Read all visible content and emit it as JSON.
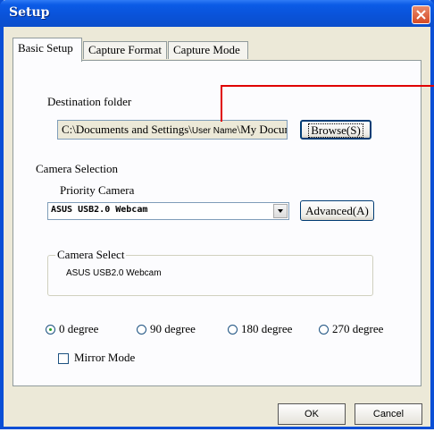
{
  "window": {
    "title": "Setup"
  },
  "tabs": [
    {
      "label": "Basic Setup",
      "active": true
    },
    {
      "label": "Capture Format",
      "active": false
    },
    {
      "label": "Capture Mode",
      "active": false
    }
  ],
  "destination": {
    "label": "Destination folder",
    "path_prefix": "C:\\Documents and Settings\\",
    "path_user": "User Name",
    "path_suffix": "\\My Docum",
    "browse_label": "Browse(S)"
  },
  "camera": {
    "section_label": "Camera Selection",
    "priority_label": "Priority Camera",
    "selected": "ASUS USB2.0 Webcam",
    "advanced_label": "Advanced(A)",
    "select_group_label": "Camera Select",
    "select_group_value": "ASUS USB2.0 Webcam"
  },
  "rotation": {
    "options": [
      "0 degree",
      "90 degree",
      "180 degree",
      "270 degree"
    ],
    "selected": "0 degree"
  },
  "mirror": {
    "label": "Mirror Mode",
    "checked": false
  },
  "footer": {
    "ok_label": "OK",
    "cancel_label": "Cancel"
  },
  "colors": {
    "titlebar": "#0a52d8",
    "annotation_line": "#e00000",
    "close": "#d64a25"
  }
}
